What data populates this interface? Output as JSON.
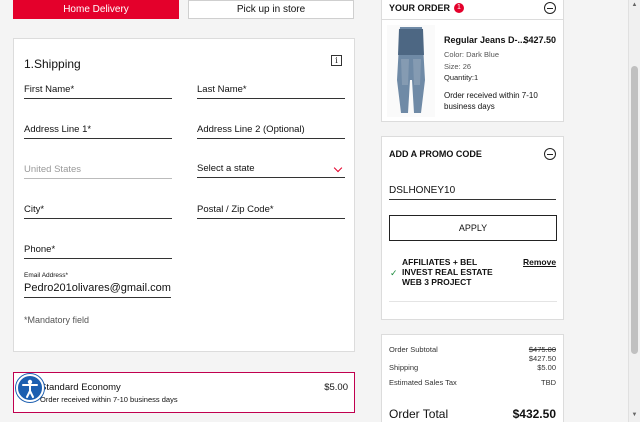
{
  "delivery_toggle": {
    "home": "Home Delivery",
    "pickup": "Pick up in store"
  },
  "shipping": {
    "title": "1.Shipping",
    "first_name": "First Name*",
    "last_name": "Last Name*",
    "address1": "Address Line 1*",
    "address2": "Address Line 2 (Optional)",
    "country": "United States",
    "state": "Select a state",
    "city": "City*",
    "zip": "Postal / Zip Code*",
    "phone": "Phone*",
    "email_label": "Email Address*",
    "email_value": "Pedro201olivares@gmail.com",
    "mandatory": "*Mandatory field"
  },
  "method": {
    "name": "Standard Economy",
    "sub": "Order received within 7-10 business days",
    "price": "$5.00"
  },
  "order": {
    "title": "YOUR ORDER",
    "count": "1",
    "item": {
      "name": "Regular Jeans D-...",
      "price": "$427.50",
      "color": "Color: Dark Blue",
      "size": "Size: 26",
      "qty": "Quantity:1",
      "note": "Order received within 7-10 business days"
    }
  },
  "promo": {
    "title": "ADD A PROMO CODE",
    "code": "DSLHONEY10",
    "apply": "APPLY",
    "applied": "AFFILIATES + BEL INVEST REAL ESTATE WEB 3 PROJECT",
    "remove": "Remove"
  },
  "summary": {
    "subtotal_label": "Order Subtotal",
    "subtotal_old": "$475.00",
    "subtotal_new": "$427.50",
    "shipping_label": "Shipping",
    "shipping_val": "$5.00",
    "tax_label": "Estimated Sales Tax",
    "tax_val": "TBD",
    "total_label": "Order Total",
    "total_val": "$432.50"
  },
  "colors": {
    "accent": "#e4002b",
    "method_border": "#c0004f",
    "accessibility": "#1c5fb0"
  }
}
